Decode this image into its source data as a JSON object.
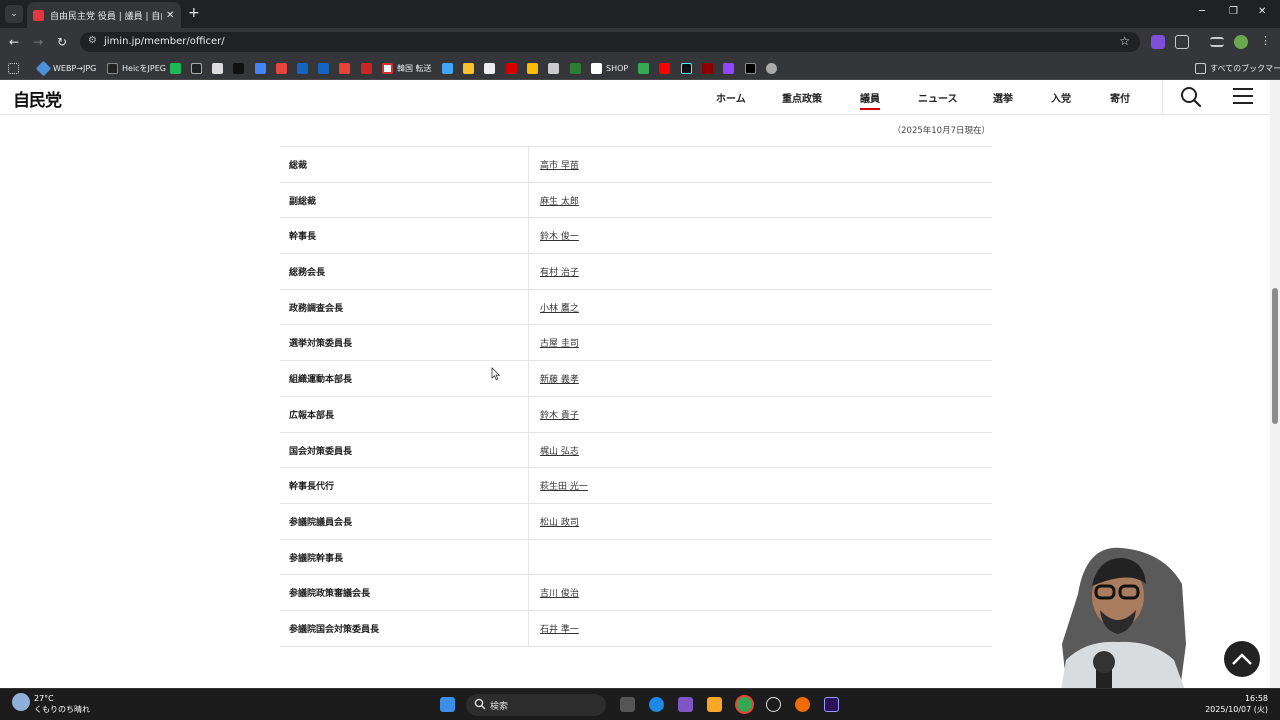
{
  "browser": {
    "tab_title": "自由民主党 役員 | 議員 | 自由民主党",
    "url": "jimin.jp/member/officer/",
    "bookmarks": [
      "WEBP→JPG",
      "HeicをJPEG",
      "韓国 転送",
      "SHOP"
    ],
    "bookmarks_folder": "すべてのブックマーク"
  },
  "site": {
    "logo": "自民党",
    "nav": [
      "ホーム",
      "重点政策",
      "議員",
      "ニュース",
      "選挙",
      "入党",
      "寄付"
    ],
    "active_nav": "議員"
  },
  "officers": {
    "as_of": "（2025年10月7日現在）",
    "rows": [
      {
        "position": "総裁",
        "name": "高市 早苗"
      },
      {
        "position": "副総裁",
        "name": "麻生 太郎"
      },
      {
        "position": "幹事長",
        "name": "鈴木 俊一"
      },
      {
        "position": "総務会長",
        "name": "有村 治子"
      },
      {
        "position": "政務調査会長",
        "name": "小林 鷹之"
      },
      {
        "position": "選挙対策委員長",
        "name": "古屋 圭司"
      },
      {
        "position": "組織運動本部長",
        "name": "新藤 義孝"
      },
      {
        "position": "広報本部長",
        "name": "鈴木 貴子"
      },
      {
        "position": "国会対策委員長",
        "name": "梶山 弘志"
      },
      {
        "position": "幹事長代行",
        "name": "萩生田 光一"
      },
      {
        "position": "参議院議員会長",
        "name": "松山 政司"
      },
      {
        "position": "参議院幹事長",
        "name": ""
      },
      {
        "position": "参議院政策審議会長",
        "name": "吉川 俊治"
      },
      {
        "position": "参議院国会対策委員長",
        "name": "石井 準一"
      }
    ]
  },
  "taskbar": {
    "weather_temp": "27°C",
    "weather_desc": "くもりのち晴れ",
    "search_label": "検索",
    "time": "16:58",
    "date": "2025/10/07 (火)"
  },
  "colors": {
    "accent": "#d7000f",
    "browser_dark": "#202124",
    "toolbar": "#35363a"
  }
}
